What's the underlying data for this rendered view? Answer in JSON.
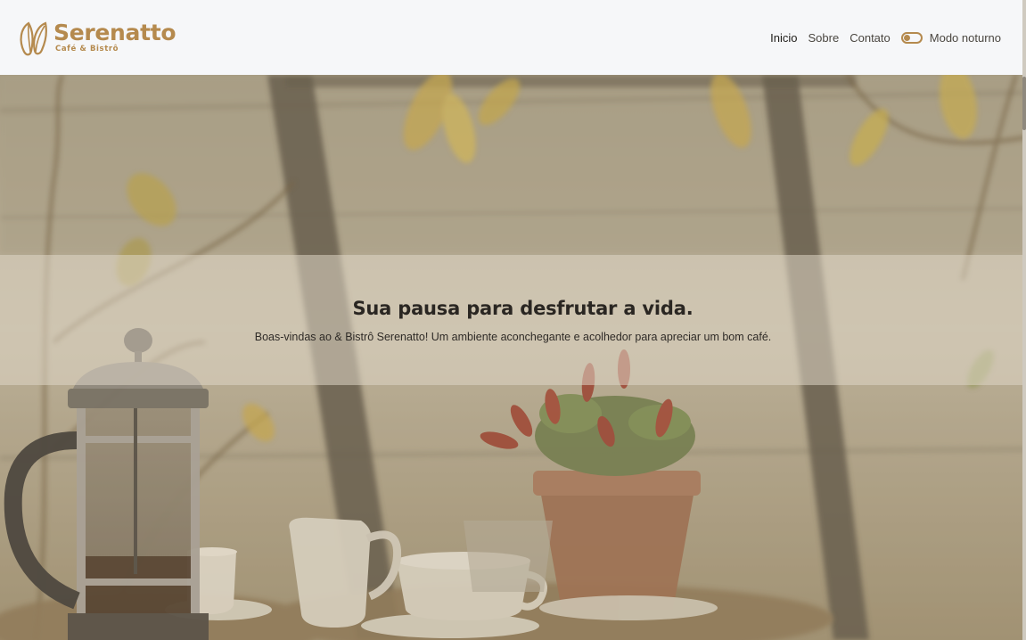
{
  "brand": {
    "name": "Serenatto",
    "tagline": "Café & Bistrô",
    "accent_color": "#b58a4e",
    "icon": "coffee-bean-leaf-icon"
  },
  "nav": {
    "items": [
      {
        "label": "Inicio",
        "active": true
      },
      {
        "label": "Sobre",
        "active": false
      },
      {
        "label": "Contato",
        "active": false
      }
    ],
    "dark_mode": {
      "label": "Modo noturno",
      "enabled": false
    }
  },
  "hero": {
    "title": "Sua pausa para desfrutar a vida.",
    "subtitle": "Boas-vindas ao & Bistrô Serenatto! Um ambiente aconchegante e acolhedor para apreciar um bom café."
  }
}
